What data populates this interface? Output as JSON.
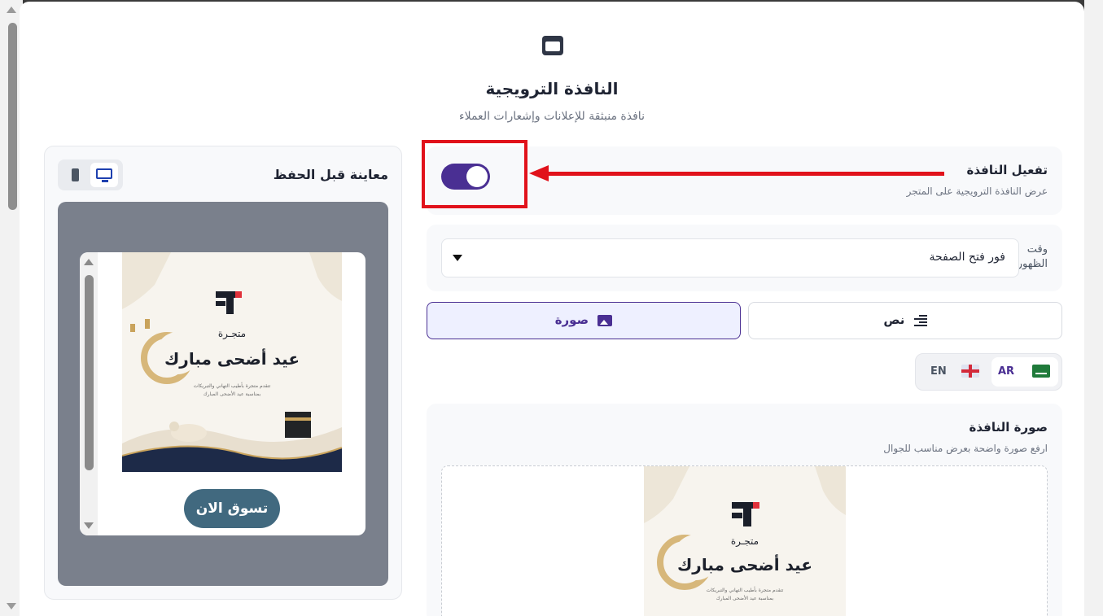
{
  "modal": {
    "title": "النافذة الترويجية",
    "subtitle": "نافذة منبثقة للإعلانات وإشعارات العملاء"
  },
  "activation": {
    "label": "تفعيل النافذة",
    "description": "عرض النافذة الترويجية على المتجر",
    "enabled": true
  },
  "display_time": {
    "label": "وقت الظهور",
    "selected": "فور فتح الصفحة"
  },
  "content_type": {
    "text_label": "نص",
    "image_label": "صورة",
    "active": "image"
  },
  "language": {
    "ar_label": "AR",
    "en_label": "EN",
    "active": "AR"
  },
  "popup_image": {
    "label": "صورة النافذة",
    "description": "ارفع صورة واضحة بعرض مناسب للجوال",
    "brand": "متجـرة",
    "headline": "عيد أضحى مبارك",
    "body_line1": "تتقدم متجرة بأطيب التهاني والتبريكات",
    "body_line2": "بمناسبة عيد الأضحى المبارك"
  },
  "preview": {
    "title": "معاينة قبل الحفظ",
    "device_active": "desktop",
    "button_label": "تسوق الان",
    "button_color": "#41697f"
  },
  "colors": {
    "accent": "#4a2f93",
    "annotation": "#e1121b"
  }
}
